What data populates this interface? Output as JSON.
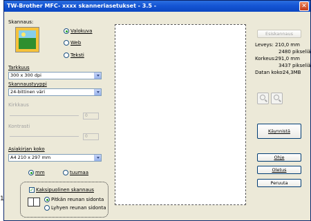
{
  "callout": "1",
  "window": {
    "title": "TW-Brother MFC- xxxx skanneriasetukset - 3.5 -",
    "close_glyph": "✕"
  },
  "scan": {
    "group_label": "Skannaus:",
    "options": [
      {
        "label": "Valokuva",
        "selected": true
      },
      {
        "label": "Web",
        "selected": false
      },
      {
        "label": "Teksti",
        "selected": false
      }
    ]
  },
  "resolution": {
    "label": "Tarkkuus",
    "value": "300 x 300 dpi"
  },
  "scan_type": {
    "label": "Skannaustyyppi",
    "value": "24-bittinen väri"
  },
  "brightness": {
    "label": "Kirkkaus",
    "value": "0"
  },
  "contrast": {
    "label": "Kontrasti",
    "value": "0"
  },
  "doc_size": {
    "label": "Asiakirjan koko",
    "value": "A4 210 x 297 mm"
  },
  "units": [
    {
      "label": "mm",
      "selected": true
    },
    {
      "label": "tuumaa",
      "selected": false
    }
  ],
  "duplex": {
    "checkbox_label": "Kaksipuolinen skannaus",
    "checked": true,
    "options": [
      {
        "label": "Pitkän reunan sidonta",
        "selected": true
      },
      {
        "label": "Lyhyen reunan sidonta",
        "selected": false
      }
    ]
  },
  "right": {
    "prescan": "Esiskannaus",
    "width_label": "Leveys:",
    "width_mm": "210,0 mm",
    "width_px": "2480 pikseliä",
    "height_label": "Korkeus:",
    "height_mm": "291,0 mm",
    "height_px": "3437 pikseliä",
    "datasize_label": "Datan koko:",
    "datasize": "24,3MB",
    "start": "Käynnistä",
    "help": "Ohje",
    "defaults": "Oletus",
    "cancel": "Peruuta"
  }
}
